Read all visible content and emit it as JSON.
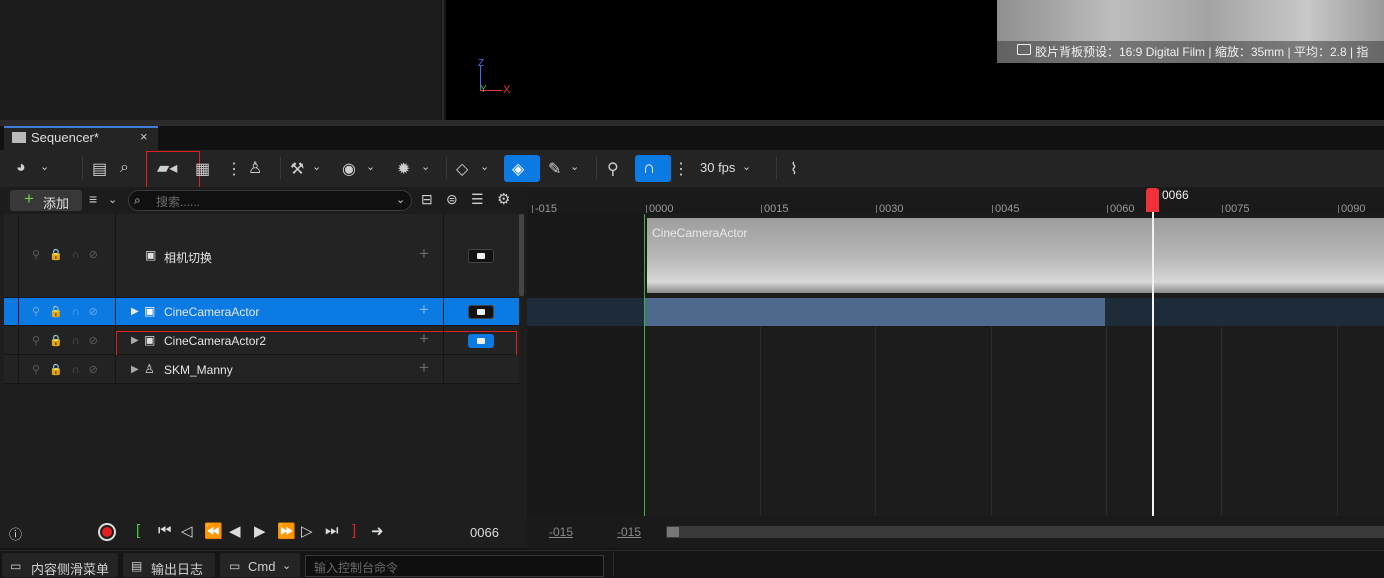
{
  "viewport": {
    "camera_info": "胶片背板预设：16:9 Digital Film | 缩放：35mm | 平均：2.8 | 指",
    "axis_z": "Z",
    "axis_y": "Y",
    "axis_x": "X"
  },
  "tab": {
    "title": "Sequencer*",
    "close": "×"
  },
  "toolbar": {
    "fps": "30 fps"
  },
  "tree": {
    "add_label": "添加",
    "search_placeholder": "搜索......",
    "rows": [
      {
        "label": "相机切换",
        "camera_active": false
      },
      {
        "label": "CineCameraActor",
        "camera_active": false
      },
      {
        "label": "CineCameraActor2",
        "camera_active": true
      },
      {
        "label": "SKM_Manny"
      }
    ]
  },
  "timeline": {
    "ticks": [
      "-015",
      "0000",
      "0015",
      "0030",
      "0045",
      "0060",
      "0075",
      "0090"
    ],
    "current_frame": "0066",
    "section_label": "CineCameraActor"
  },
  "transport": {
    "frame": "0066",
    "range_start": "-015",
    "range_end": "-015"
  },
  "statusbar": {
    "content_drawer": "内容侧滑菜单",
    "output_log": "输出日志",
    "cmd": "Cmd",
    "console_placeholder": "输入控制台命令"
  }
}
